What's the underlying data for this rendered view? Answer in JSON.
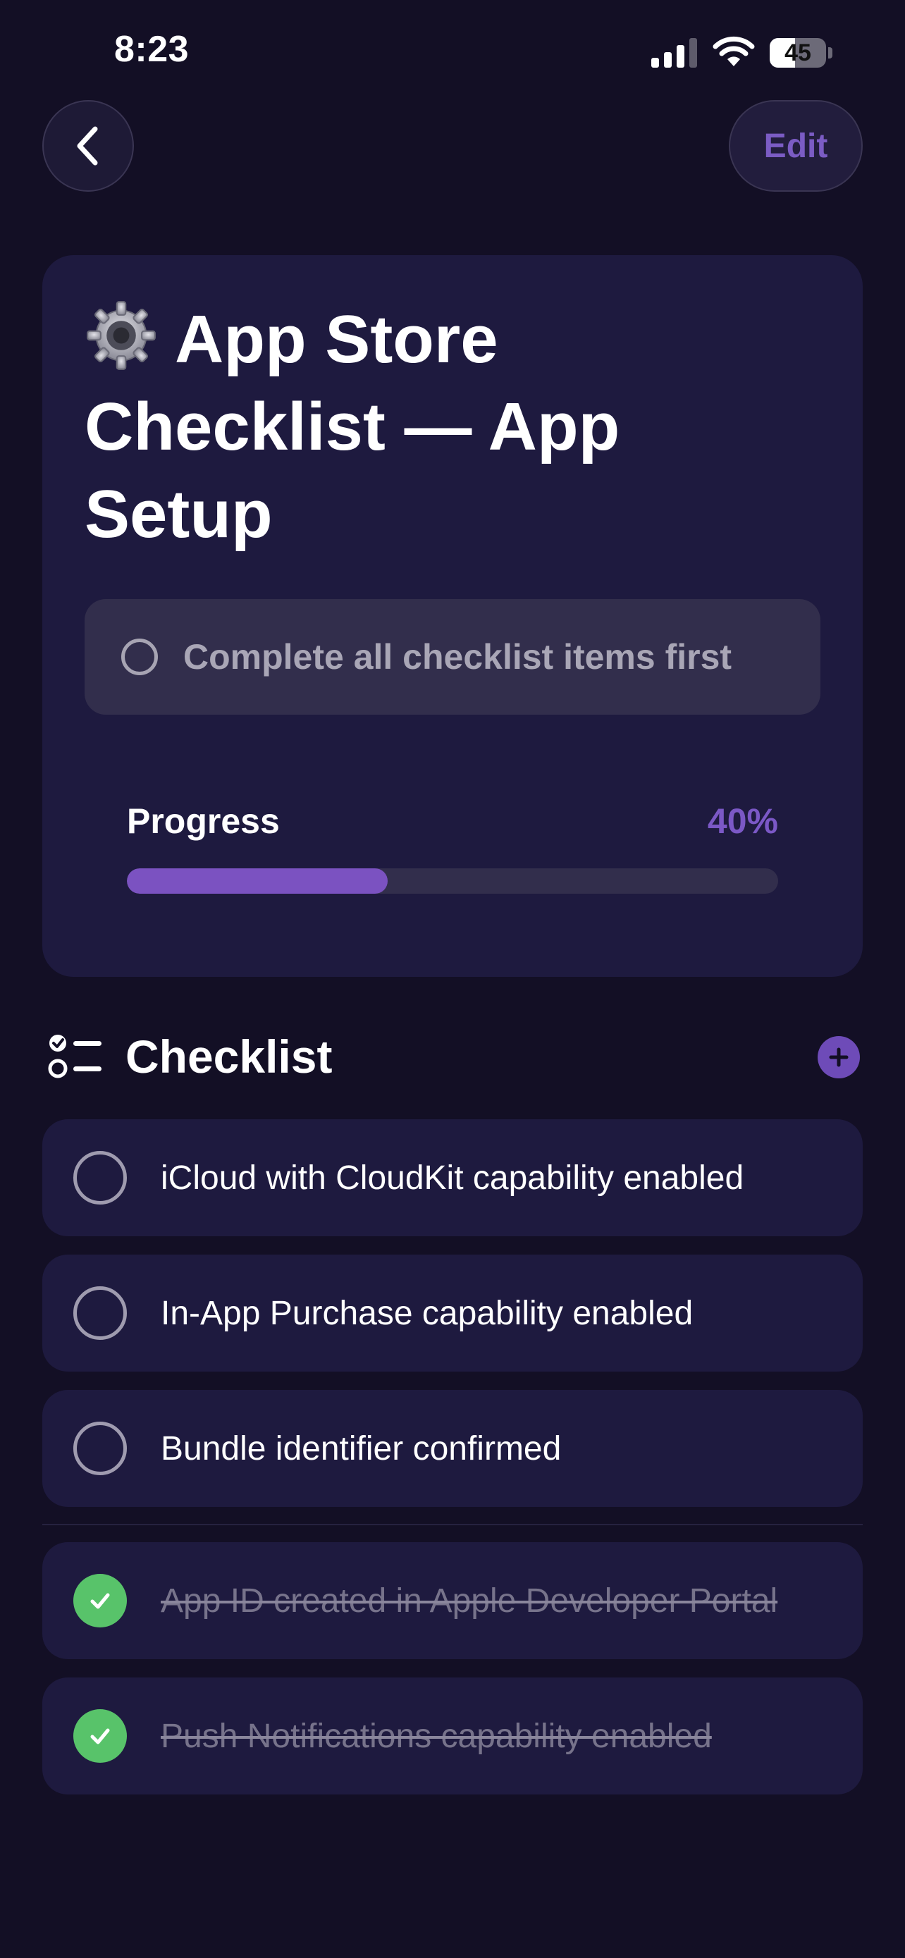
{
  "status_bar": {
    "time": "8:23",
    "battery": "45",
    "battery_level": 0.45,
    "icons": [
      "signal-icon",
      "wifi-icon",
      "battery-icon"
    ]
  },
  "nav": {
    "back_icon": "chevron-left-icon",
    "edit_label": "Edit"
  },
  "header": {
    "title_icon": "gear-icon",
    "title": "App Store Checklist — App Setup",
    "notice_text": "Complete all checklist items first",
    "progress_label": "Progress",
    "progress_value": "40%",
    "progress_fraction": 0.4
  },
  "checklist": {
    "title": "Checklist",
    "icon": "checklist-icon",
    "add_icon": "plus-circle-icon",
    "items": [
      {
        "label": "iCloud with CloudKit capability enabled",
        "done": false
      },
      {
        "label": "In-App Purchase capability enabled",
        "done": false
      },
      {
        "label": "Bundle identifier confirmed",
        "done": false
      },
      {
        "label": "App ID created in Apple Developer Portal",
        "done": true
      },
      {
        "label": "Push Notifications capability enabled",
        "done": true
      }
    ]
  },
  "colors": {
    "background": "#130f25",
    "card": "#1e1a3f",
    "accent": "#7b52c1",
    "done_green": "#58c36a"
  }
}
